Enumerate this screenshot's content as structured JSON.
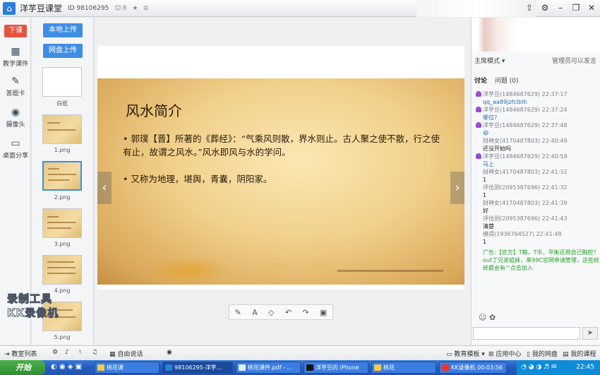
{
  "window": {
    "app_title": "洋芋豆课堂",
    "room_id": "ID 98106295",
    "online_count": "8"
  },
  "left_tools": {
    "class_button": "下课",
    "items": [
      {
        "label": "教学课件",
        "icon": "courseware-icon"
      },
      {
        "label": "答题卡",
        "icon": "answer-card-icon"
      },
      {
        "label": "摄像头",
        "icon": "camera-icon"
      },
      {
        "label": "桌面分享",
        "icon": "desktop-share-icon"
      }
    ]
  },
  "thumbs": {
    "upload_local": "本地上传",
    "upload_cloud": "网盘上传",
    "slides": [
      "白纸",
      "1.png",
      "2.png",
      "3.png",
      "4.png",
      "5.png"
    ],
    "selected_index": 2
  },
  "slide": {
    "title": "风水简介",
    "bullets": [
      "郭璞【晋】所著的《葬经》：“气乘风则散，界水则止。古人聚之使不散，行之使有止，故谓之风水。”风水即风与水的学问。",
      "又称为地理，堪舆，青囊，阴阳家。"
    ]
  },
  "watermark": {
    "line1": "录制工具",
    "line2": "KK录像机"
  },
  "chat": {
    "mode_label": "主席模式",
    "mode_note": "管理员可以发言",
    "tab_discuss": "讨论",
    "tab_question": "问题 (0)",
    "messages": [
      {
        "user": "洋芋豆(1484687629) 22:37:17",
        "text": "qq_aa89jzfclblh",
        "teacher": true
      },
      {
        "user": "洋芋豆(1484687629) 22:37:24",
        "text": "哪位?",
        "teacher": true
      },
      {
        "user": "洋芋豆(1484687629) 22:37:48",
        "text": "😄",
        "teacher": true
      },
      {
        "user": "财神女(4170487803) 22:40:49",
        "text": "还没开始吗",
        "teacher": false
      },
      {
        "user": "洋芋豆(1484687629) 22:40:59",
        "text": "马上",
        "teacher": true
      },
      {
        "user": "财神女(4170487803) 22:41:32",
        "text": "1",
        "teacher": false
      },
      {
        "user": "评估测(2095387696) 22:41:32",
        "text": "1",
        "teacher": false
      },
      {
        "user": "财神女(4170487803) 22:41:39",
        "text": "好",
        "teacher": false
      },
      {
        "user": "评估测(2095387696) 22:41:43",
        "text": "清楚",
        "teacher": false
      },
      {
        "user": "摸得(1936764527) 22:41:48",
        "text": "1",
        "teacher": false
      }
    ],
    "ad": "广告:【官方】T粮，T币，平衡还用自己胸腔？out了兄弟姐妹，来99C官网申请管理，这些统统都会有^点击加入"
  },
  "bottom": {
    "classroom_list": "教室列表",
    "free_talk": "自由说话",
    "template": "教育模板",
    "app_center": "应用中心",
    "my_disk": "我的网盘",
    "my_courses": "我的课程"
  },
  "taskbar": {
    "start": "开始",
    "tasks": [
      "桃花课",
      "98106295-洋芋...",
      "桃花课件.pdf - ...",
      "洋芋豆的 iPhone",
      "桃花"
    ],
    "recorder": "KK录像机 00:03:56",
    "time": "22:45"
  }
}
